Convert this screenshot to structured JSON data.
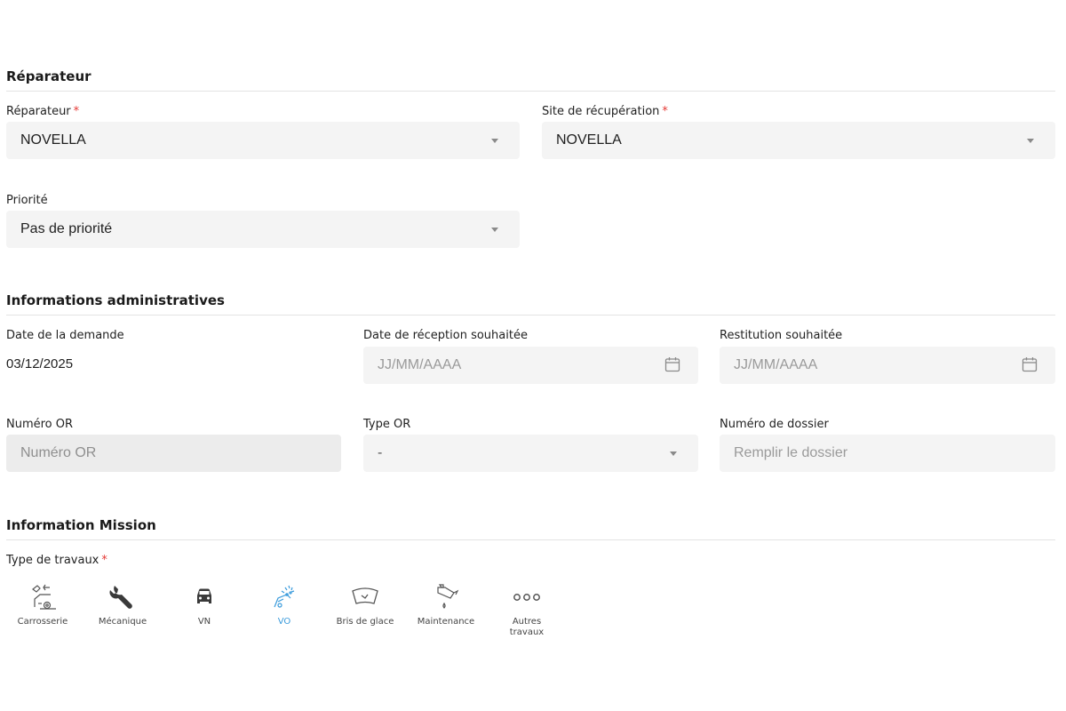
{
  "sections": {
    "reparateur": "Réparateur",
    "admin": "Informations administratives",
    "mission": "Information Mission"
  },
  "reparateur": {
    "reparateur_label": "Réparateur",
    "reparateur_value": "NOVELLA",
    "site_label": "Site de récupération",
    "site_value": "NOVELLA",
    "priorite_label": "Priorité",
    "priorite_value": "Pas de priorité",
    "required_mark": "*"
  },
  "admin": {
    "date_demande_label": "Date de la demande",
    "date_demande_value": "03/12/2025",
    "date_reception_label": "Date de réception souhaitée",
    "date_reception_placeholder": "JJ/MM/AAAA",
    "restitution_label": "Restitution souhaitée",
    "restitution_placeholder": "JJ/MM/AAAA",
    "numero_or_label": "Numéro OR",
    "numero_or_placeholder": "Numéro OR",
    "type_or_label": "Type OR",
    "type_or_value": "-",
    "dossier_label": "Numéro de dossier",
    "dossier_placeholder": "Remplir le dossier"
  },
  "mission": {
    "type_travaux_label": "Type de travaux",
    "required_mark": "*",
    "types": [
      {
        "label": "Carrosserie",
        "icon": "car-body-repair-icon"
      },
      {
        "label": "Mécanique",
        "icon": "wrench-icon"
      },
      {
        "label": "VN",
        "icon": "car-front-icon"
      },
      {
        "label": "VO",
        "icon": "car-wash-icon",
        "selected": true
      },
      {
        "label": "Bris de glace",
        "icon": "windshield-icon"
      },
      {
        "label": "Maintenance",
        "icon": "oil-can-icon"
      },
      {
        "label": "Autres travaux",
        "icon": "more-dots-icon"
      }
    ]
  },
  "colors": {
    "accent": "#3a9bdc",
    "required": "#e53935",
    "field_bg": "#f4f4f4"
  }
}
